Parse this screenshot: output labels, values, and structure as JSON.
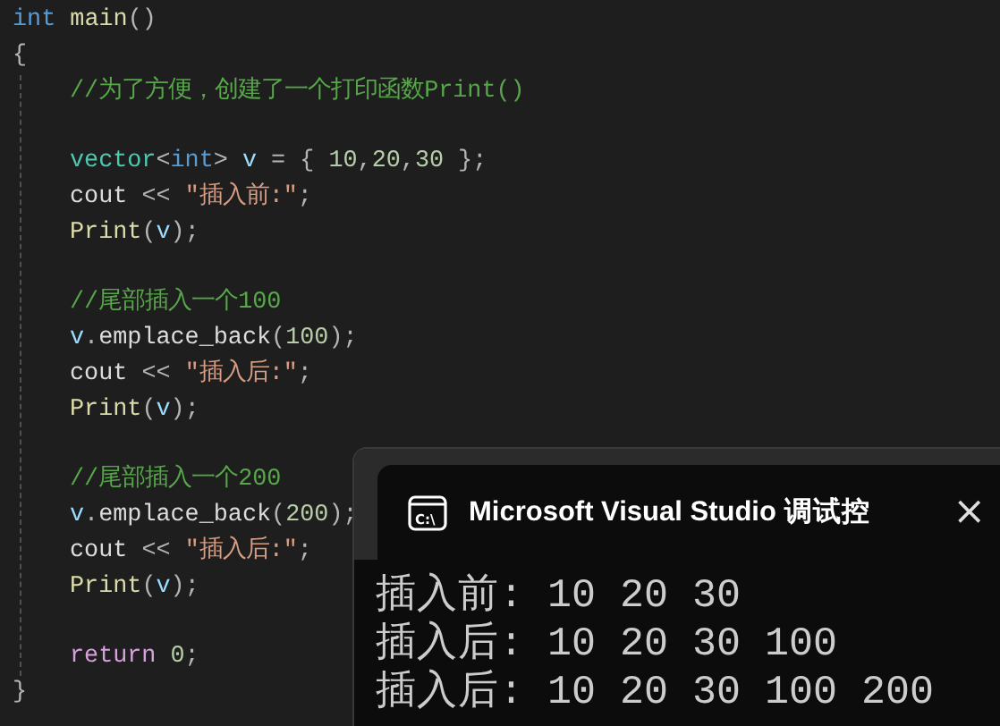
{
  "editor": {
    "lines": [
      {
        "kind": "code",
        "tokens": [
          {
            "text": "int ",
            "kind": "keyword"
          },
          {
            "text": "main",
            "kind": "function"
          },
          {
            "text": "()",
            "kind": "punct"
          }
        ]
      },
      {
        "kind": "code",
        "tokens": [
          {
            "text": "{",
            "kind": "punct"
          }
        ],
        "children": [
          {
            "kind": "code",
            "tokens": [
              {
                "text": "//为了方便，创建了一个打印函数Print()",
                "kind": "comment"
              }
            ]
          },
          {
            "kind": "blank"
          },
          {
            "kind": "code",
            "tokens": [
              {
                "text": "vector",
                "kind": "type"
              },
              {
                "text": "<",
                "kind": "punct"
              },
              {
                "text": "int",
                "kind": "keyword"
              },
              {
                "text": "> ",
                "kind": "punct"
              },
              {
                "text": "v",
                "kind": "variable"
              },
              {
                "text": " = { ",
                "kind": "punct"
              },
              {
                "text": "10",
                "kind": "number"
              },
              {
                "text": ",",
                "kind": "punct"
              },
              {
                "text": "20",
                "kind": "number"
              },
              {
                "text": ",",
                "kind": "punct"
              },
              {
                "text": "30",
                "kind": "number"
              },
              {
                "text": " };",
                "kind": "punct"
              }
            ]
          },
          {
            "kind": "code",
            "tokens": [
              {
                "text": "cout",
                "kind": "plain"
              },
              {
                "text": " << ",
                "kind": "punct"
              },
              {
                "text": "\"插入前:\"",
                "kind": "string"
              },
              {
                "text": ";",
                "kind": "punct"
              }
            ]
          },
          {
            "kind": "code",
            "tokens": [
              {
                "text": "Print",
                "kind": "function"
              },
              {
                "text": "(",
                "kind": "punct"
              },
              {
                "text": "v",
                "kind": "variable"
              },
              {
                "text": ");",
                "kind": "punct"
              }
            ]
          },
          {
            "kind": "blank"
          },
          {
            "kind": "code",
            "tokens": [
              {
                "text": "//尾部插入一个100",
                "kind": "comment"
              }
            ]
          },
          {
            "kind": "code",
            "tokens": [
              {
                "text": "v",
                "kind": "variable"
              },
              {
                "text": ".",
                "kind": "punct"
              },
              {
                "text": "emplace_back",
                "kind": "plain"
              },
              {
                "text": "(",
                "kind": "punct"
              },
              {
                "text": "100",
                "kind": "number"
              },
              {
                "text": ");",
                "kind": "punct"
              }
            ]
          },
          {
            "kind": "code",
            "tokens": [
              {
                "text": "cout",
                "kind": "plain"
              },
              {
                "text": " << ",
                "kind": "punct"
              },
              {
                "text": "\"插入后:\"",
                "kind": "string"
              },
              {
                "text": ";",
                "kind": "punct"
              }
            ]
          },
          {
            "kind": "code",
            "tokens": [
              {
                "text": "Print",
                "kind": "function"
              },
              {
                "text": "(",
                "kind": "punct"
              },
              {
                "text": "v",
                "kind": "variable"
              },
              {
                "text": ");",
                "kind": "punct"
              }
            ]
          },
          {
            "kind": "blank"
          },
          {
            "kind": "code",
            "tokens": [
              {
                "text": "//尾部插入一个200",
                "kind": "comment"
              }
            ]
          },
          {
            "kind": "code",
            "tokens": [
              {
                "text": "v",
                "kind": "variable"
              },
              {
                "text": ".",
                "kind": "punct"
              },
              {
                "text": "emplace_back",
                "kind": "plain"
              },
              {
                "text": "(",
                "kind": "punct"
              },
              {
                "text": "200",
                "kind": "number"
              },
              {
                "text": ");",
                "kind": "punct"
              }
            ]
          },
          {
            "kind": "code",
            "tokens": [
              {
                "text": "cout",
                "kind": "plain"
              },
              {
                "text": " << ",
                "kind": "punct"
              },
              {
                "text": "\"插入后:\"",
                "kind": "string"
              },
              {
                "text": ";",
                "kind": "punct"
              }
            ]
          },
          {
            "kind": "code",
            "tokens": [
              {
                "text": "Print",
                "kind": "function"
              },
              {
                "text": "(",
                "kind": "punct"
              },
              {
                "text": "v",
                "kind": "variable"
              },
              {
                "text": ");",
                "kind": "punct"
              }
            ]
          },
          {
            "kind": "blank"
          },
          {
            "kind": "code",
            "tokens": [
              {
                "text": "return ",
                "kind": "control"
              },
              {
                "text": "0",
                "kind": "number"
              },
              {
                "text": ";",
                "kind": "punct"
              }
            ]
          }
        ]
      },
      {
        "kind": "code",
        "tokens": [
          {
            "text": "}",
            "kind": "punct"
          }
        ]
      }
    ]
  },
  "console": {
    "icon_text": "C:\\",
    "title": "Microsoft Visual Studio 调试控",
    "close": "×",
    "output": [
      "插入前: 10 20 30",
      "插入后: 10 20 30 100",
      "插入后: 10 20 30 100 200"
    ]
  }
}
